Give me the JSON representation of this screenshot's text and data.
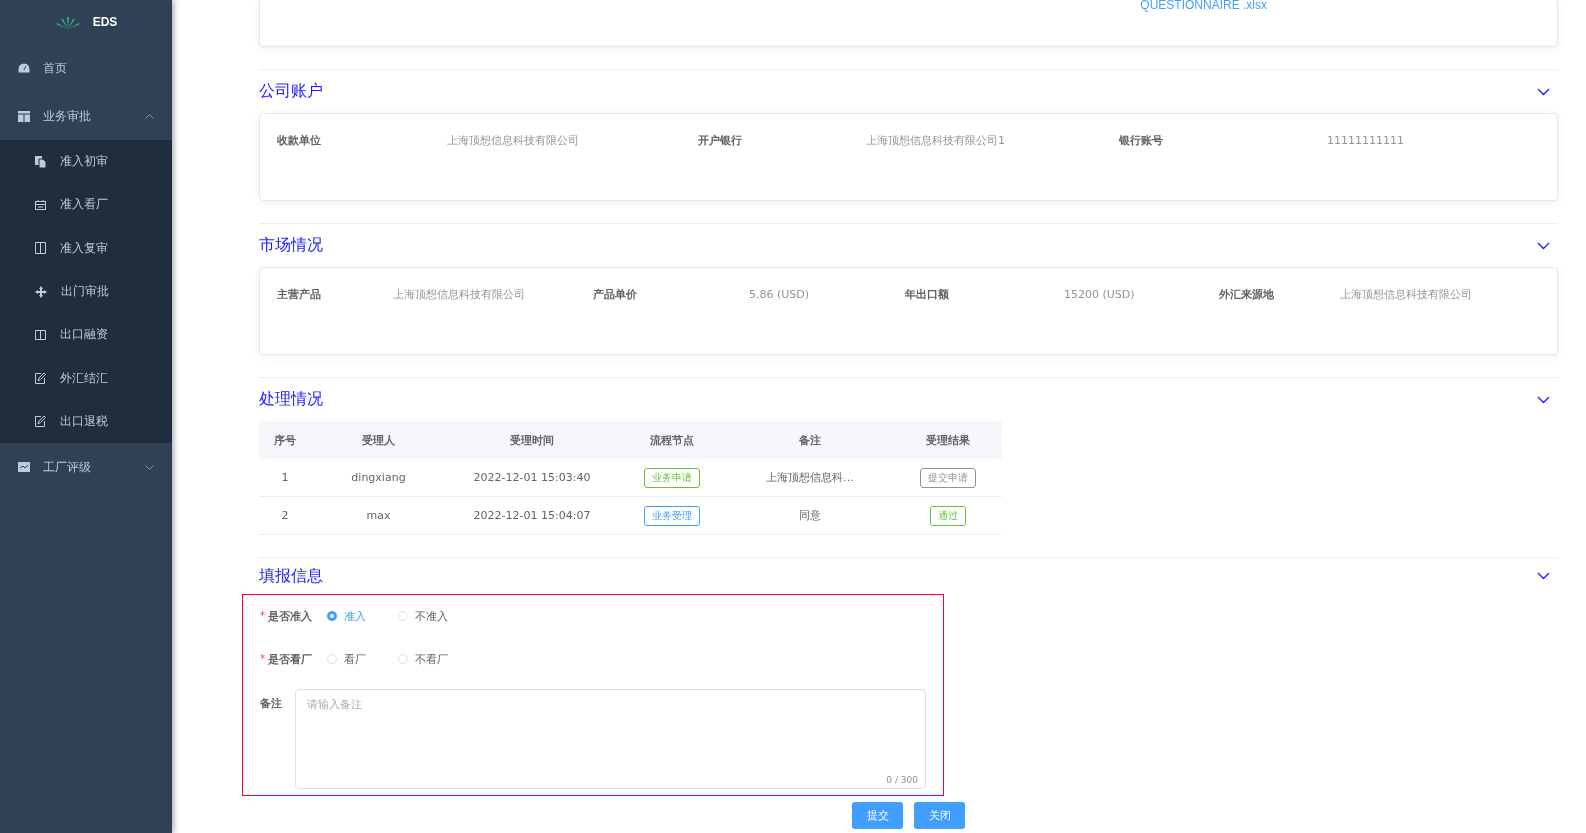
{
  "sidebar": {
    "logo": "EDS",
    "items": [
      {
        "label": "首页",
        "kind": "dashboard"
      },
      {
        "label": "业务审批",
        "kind": "table",
        "expanded": true,
        "children": [
          {
            "label": "准入初审",
            "kind": "copy"
          },
          {
            "label": "准入看厂",
            "kind": "calendar"
          },
          {
            "label": "准入复审",
            "kind": "columns"
          },
          {
            "label": "出门审批",
            "kind": "move"
          },
          {
            "label": "出口融资",
            "kind": "panel"
          },
          {
            "label": "外汇结汇",
            "kind": "edit"
          },
          {
            "label": "出口退税",
            "kind": "edit"
          }
        ]
      },
      {
        "label": "工厂评级",
        "kind": "chart",
        "expanded": false
      }
    ]
  },
  "top_card": {
    "file_link": "QUESTIONNAIRE .xlsx"
  },
  "sections": [
    {
      "title": "公司账户",
      "expanded": true,
      "fields": [
        {
          "label": "收款单位",
          "value": "上海顶想信息科技有限公司"
        },
        {
          "label": "开户银行",
          "value": "上海顶想信息科技有限公司1"
        },
        {
          "label": "银行账号",
          "value": "11111111111"
        }
      ]
    },
    {
      "title": "市场情况",
      "expanded": true,
      "fields": [
        {
          "label": "主营产品",
          "value": "上海顶想信息科技有限公司"
        },
        {
          "label": "产品单价",
          "value": "5.86 (USD)"
        },
        {
          "label": "年出口额",
          "value": "15200 (USD)"
        },
        {
          "label": "外汇来源地",
          "value": "上海顶想信息科技有限公司"
        }
      ]
    }
  ],
  "processing": {
    "title": "处理情况",
    "expanded": true,
    "columns": [
      "序号",
      "受理人",
      "受理时间",
      "流程节点",
      "备注",
      "受理结果"
    ],
    "rows": [
      {
        "no": "1",
        "person": "dingxiang",
        "time": "2022-12-01 15:03:40",
        "node": {
          "text": "业务申请",
          "color": "#67c23a"
        },
        "remark": "上海顶想信息科...",
        "result": {
          "text": "提交申请",
          "color": "#909399"
        }
      },
      {
        "no": "2",
        "person": "max",
        "time": "2022-12-01 15:04:07",
        "node": {
          "text": "业务受理",
          "color": "#409eff"
        },
        "remark": "同意",
        "result": {
          "text": "通过",
          "color": "#67c23a"
        }
      }
    ]
  },
  "form": {
    "title": "填报信息",
    "expanded": true,
    "radio_groups": [
      {
        "label": "是否准入",
        "required": true,
        "options": [
          {
            "label": "准入",
            "selected": true
          },
          {
            "label": "不准入",
            "selected": false
          }
        ]
      },
      {
        "label": "是否看厂",
        "required": true,
        "options": [
          {
            "label": "看厂",
            "selected": false
          },
          {
            "label": "不看厂",
            "selected": false
          }
        ]
      }
    ],
    "remark": {
      "label": "备注",
      "placeholder": "请输入备注",
      "counter": "0 / 300"
    },
    "buttons": [
      "提交",
      "关闭"
    ]
  }
}
